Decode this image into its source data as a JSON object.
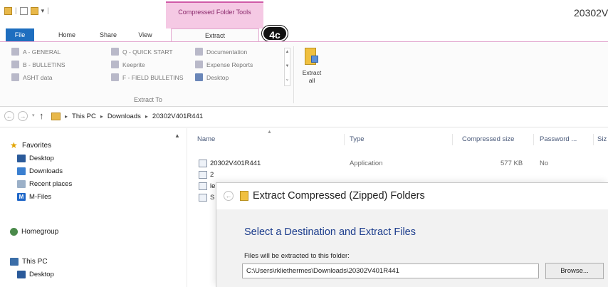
{
  "window": {
    "title": "20302V",
    "context_tab_group": "Compressed Folder Tools",
    "step_badge": "4c"
  },
  "tabs": [
    {
      "label": "File"
    },
    {
      "label": "Home"
    },
    {
      "label": "Share"
    },
    {
      "label": "View"
    },
    {
      "label": "Extract"
    }
  ],
  "ribbon": {
    "extract_to_label": "Extract To",
    "extract_all_label": "Extract all",
    "destinations": [
      {
        "label": "A - GENERAL"
      },
      {
        "label": "B - BULLETINS"
      },
      {
        "label": "ASHT data"
      },
      {
        "label": "Q - QUICK START"
      },
      {
        "label": "Keeprite"
      },
      {
        "label": "F - FIELD BULLETINS"
      },
      {
        "label": "Documentation"
      },
      {
        "label": "Expense Reports"
      },
      {
        "label": "Desktop"
      }
    ]
  },
  "address": {
    "crumbs": [
      "This PC",
      "Downloads",
      "20302V401R441"
    ]
  },
  "nav": {
    "favorites": "Favorites",
    "desktop": "Desktop",
    "downloads": "Downloads",
    "recent": "Recent places",
    "mfiles": "M-Files",
    "homegroup": "Homegroup",
    "thispc": "This PC",
    "pc_desktop": "Desktop"
  },
  "content": {
    "columns": [
      "Name",
      "Type",
      "Compressed size",
      "Password ...",
      "Siz"
    ],
    "files": [
      {
        "name": "20302V401R441",
        "type": "Application",
        "compressed_size": "577 KB",
        "password": "No"
      },
      {
        "name": "2"
      },
      {
        "name": "le"
      },
      {
        "name": "S"
      }
    ]
  },
  "dialog": {
    "title": "Extract Compressed (Zipped) Folders",
    "heading": "Select a Destination and Extract Files",
    "field_label": "Files will be extracted to this folder:",
    "path_value": "C:\\Users\\rkliethermes\\Downloads\\20302V401R441",
    "browse_label": "Browse..."
  }
}
